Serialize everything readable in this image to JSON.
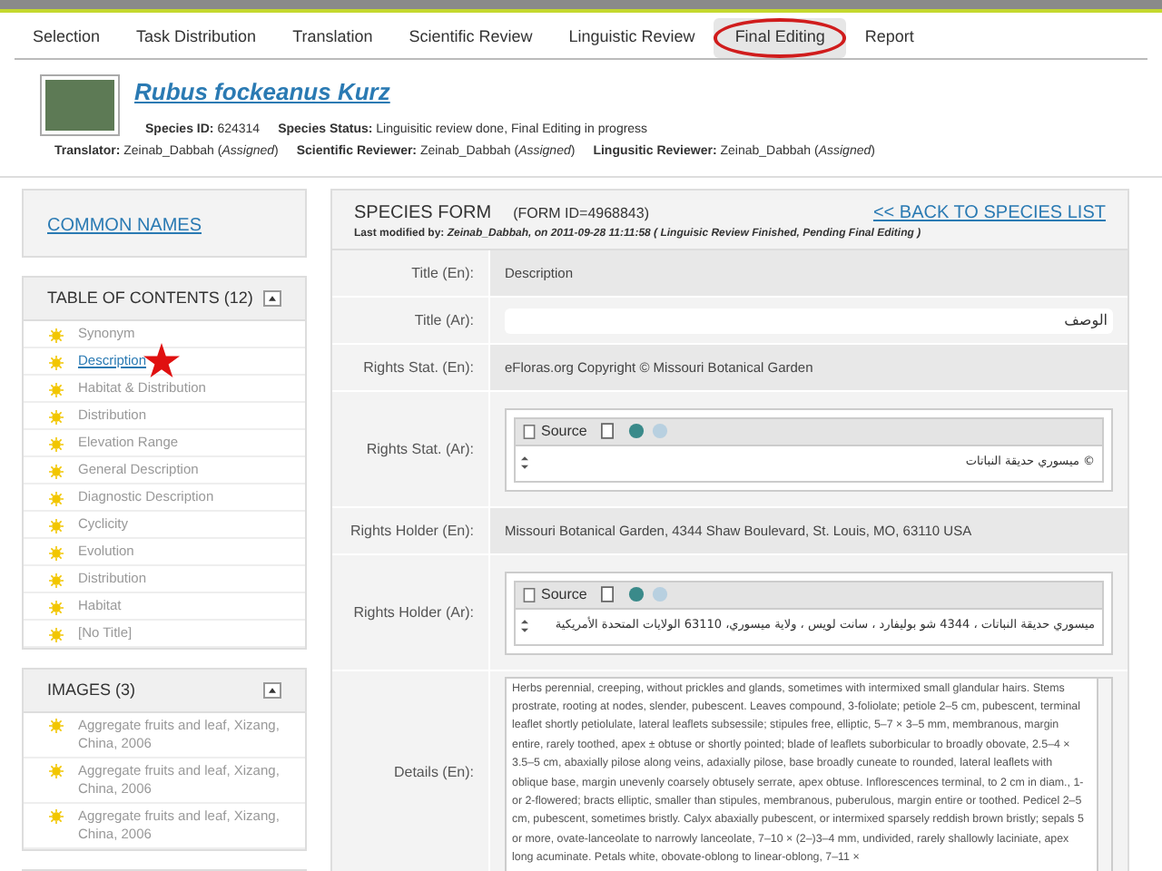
{
  "tabs": [
    {
      "label": "Selection",
      "selected": false
    },
    {
      "label": "Task Distribution",
      "selected": false
    },
    {
      "label": "Translation",
      "selected": false
    },
    {
      "label": "Scientific Review",
      "selected": false
    },
    {
      "label": "Linguistic Review",
      "selected": false
    },
    {
      "label": "Final Editing",
      "selected": true
    },
    {
      "label": "Report",
      "selected": false
    }
  ],
  "species": {
    "name": "Rubus fockeanus Kurz",
    "meta_line_1": [
      {
        "label": "Species ID:",
        "value": "624314"
      },
      {
        "label": "Species Status:",
        "value": "Linguisitic review done, Final Editing in progress"
      }
    ],
    "meta_line_2": [
      {
        "label": "Translator:",
        "value": "Zeinab_Dabbah (*Assigned*)"
      },
      {
        "label": "Scientific Reviewer:",
        "value": "Zeinab_Dabbah (*Assigned*)"
      },
      {
        "label": "Lingusitic Reviewer:",
        "value": "Zeinab_Dabbah (*Assigned*)"
      }
    ]
  },
  "sidebar": {
    "common_names": "COMMON NAMES",
    "toc": {
      "title": "TABLE OF CONTENTS (12)",
      "items": [
        {
          "label": "Synonym",
          "selected": false
        },
        {
          "label": "Description",
          "selected": true
        },
        {
          "label": "Habitat & Distribution",
          "selected": false
        },
        {
          "label": "Distribution",
          "selected": false
        },
        {
          "label": "Elevation Range",
          "selected": false
        },
        {
          "label": "General Description",
          "selected": false
        },
        {
          "label": "Diagnostic Description",
          "selected": false
        },
        {
          "label": "Cyclicity",
          "selected": false
        },
        {
          "label": "Evolution",
          "selected": false
        },
        {
          "label": "Distribution",
          "selected": false
        },
        {
          "label": "Habitat",
          "selected": false
        },
        {
          "label": "[No Title]",
          "selected": false
        }
      ]
    },
    "images": {
      "title": "IMAGES (3)",
      "items": [
        {
          "label": "Aggregate fruits and leaf, Xizang, China, 2006"
        },
        {
          "label": "Aggregate fruits and leaf, Xizang, China, 2006"
        },
        {
          "label": "Aggregate fruits and leaf, Xizang, China, 2006"
        }
      ]
    }
  },
  "form": {
    "title": "SPECIES FORM",
    "form_id": "(FORM ID=4968843)",
    "back_link": "<< BACK TO SPECIES LIST",
    "last_modified": "Last modified by: *Zeinab_Dabbah, on 2011-09-28 11:11:58 ( Linguisic Review Finished, Pending Final Editing )*",
    "rows": [
      {
        "kind": "text",
        "label": "Title (En):",
        "value": "Description"
      },
      {
        "kind": "input",
        "label": "Title (Ar):",
        "value": "الوصف"
      },
      {
        "kind": "text",
        "label": "Rights Stat. (En):",
        "value": "eFloras.org Copyright © Missouri Botanical Garden"
      },
      {
        "kind": "editor",
        "label": "Rights Stat. (Ar):",
        "source": "Source",
        "value": "© ميسوري حديقة النباتات"
      },
      {
        "kind": "text",
        "label": "Rights Holder (En):",
        "value": "Missouri Botanical Garden, 4344 Shaw Boulevard, St. Louis, MO, 63110 USA"
      },
      {
        "kind": "editor",
        "label": "Rights Holder (Ar):",
        "source": "Source",
        "value": "ميسوري حديقة النباتات ، 4344 شو بوليفارد ، سانت لويس ، ولاية ميسوري، 63110 الولايات المتحدة الأمريكية"
      },
      {
        "kind": "textarea",
        "label": "Details (En):",
        "value": "Herbs perennial, creeping, without prickles and glands, sometimes with intermixed small glandular hairs. Stems prostrate, rooting at nodes, slender, pubescent. Leaves compound, 3-foliolate; petiole 2–5 cm, pubescent, terminal leaflet shortly petiolulate, lateral leaflets subsessile; stipules free, elliptic, 5–7 × 3–5 mm, membranous, margin entire, rarely toothed, apex ± obtuse or shortly pointed; blade of leaflets suborbicular to broadly obovate, 2.5–4 × 3.5–5 cm, abaxially pilose along veins, adaxially pilose, base broadly cuneate to rounded, lateral leaflets with oblique base, margin unevenly coarsely obtusely serrate, apex obtuse. Inflorescences terminal, to 2 cm in diam., 1- or 2-flowered; bracts elliptic, smaller than stipules, membranous, puberulous, margin entire or toothed. Pedicel 2–5 cm, pubescent, sometimes bristly. Calyx abaxially pubescent, or intermixed sparsely reddish brown bristly; sepals 5 or more, ovate-lanceolate to narrowly lanceolate, 7–10 × (2–)3–4 mm, undivided, rarely shallowly laciniate, apex long acuminate. Petals white, obovate-oblong to linear-oblong, 7–11 ×"
      }
    ]
  }
}
